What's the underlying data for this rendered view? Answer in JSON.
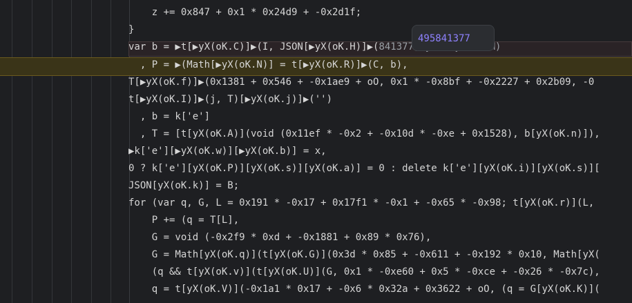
{
  "editor": {
    "tooltip_value": "495841377",
    "lines": [
      "    z += 0x847 + 0x1 * 0x24d9 + -0x2d1f;",
      "}",
      "var b = ▶t[▶yX(oK.C)]▶(I, JSON[▶yX(oK.H)]▶(",
      "  , P = ▶(Math[▶yX(oK.N)] = t[▶yX(oK.R)]▶(C, b),",
      "T[▶yX(oK.f)]▶(0x1381 + 0x546 + -0x1ae9 + oO, 0x1 * -0x8bf + -0x2227 + 0x2b09, -0",
      "t[▶yX(oK.I)]▶(j, T)[▶yX(oK.j)]▶('')",
      "  , b = k['e']",
      "  , T = [t[yX(oK.A)](void (0x11ef * -0x2 + -0x10d * -0xe + 0x1528), b[yX(oK.n)]),",
      "▶k['e'][▶yX(oK.w)][▶yX(oK.b)] = x,",
      "0 ? k['e'][yX(oK.P)][yX(oK.s)][yX(oK.a)] = 0 : delete k['e'][yX(oK.i)][yX(oK.s)][",
      "JSON[yX(oK.k)] = B;",
      "for (var q, G, L = 0x191 * -0x17 + 0x17f1 * -0x1 + -0x65 * -0x98; t[yX(oK.r)](L,",
      "    P += (q = T[L],",
      "    G = void (-0x2f9 * 0xd + -0x1881 + 0x89 * 0x76),",
      "    G = Math[yX(oK.q)](t[yX(oK.G)](0x3d * 0x85 + -0x611 + -0x192 * 0x10, Math[yX(",
      "    (q && t[yX(oK.v)](t[yX(oK.U)](G, 0x1 * -0xe60 + 0x5 * -0xce + -0x26 * -0x7c),",
      "    q = t[yX(oK.V)](-0x1a1 * 0x17 + -0x6 * 0x32a + 0x3622 + oO, (q = G[yX(oK.K)]("
    ],
    "inline_hint": "841377, yX = ƒ (t, M)"
  }
}
